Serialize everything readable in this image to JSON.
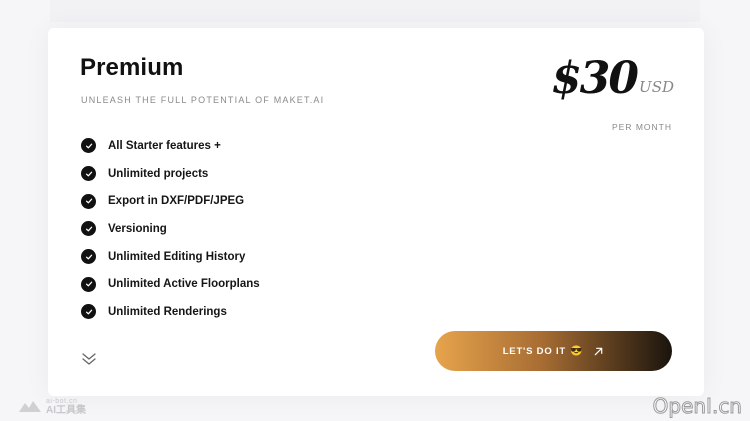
{
  "plan": {
    "title": "Premium",
    "subtitle": "UNLEASH THE FULL POTENTIAL OF MAKET.AI",
    "price": "$30",
    "currency": "USD",
    "period": "PER MONTH"
  },
  "features": [
    "All Starter features +",
    "Unlimited projects",
    "Export in DXF/PDF/JPEG",
    "Versioning",
    "Unlimited Editing History",
    "Unlimited Active Floorplans",
    "Unlimited Renderings"
  ],
  "cta": {
    "label": "LET'S DO IT",
    "emoji": "😎",
    "icon": "arrow-up-right-icon"
  },
  "expand_icon": "double-chevron-down-icon",
  "watermarks": {
    "left_small": "ai-bot.cn",
    "left_big": "AI工具集",
    "right": "OpenI.cn"
  },
  "colors": {
    "cta_gradient_start": "#e7a44c",
    "cta_gradient_end": "#1a140d",
    "text_primary": "#111111",
    "text_muted": "#8a8a8a"
  }
}
